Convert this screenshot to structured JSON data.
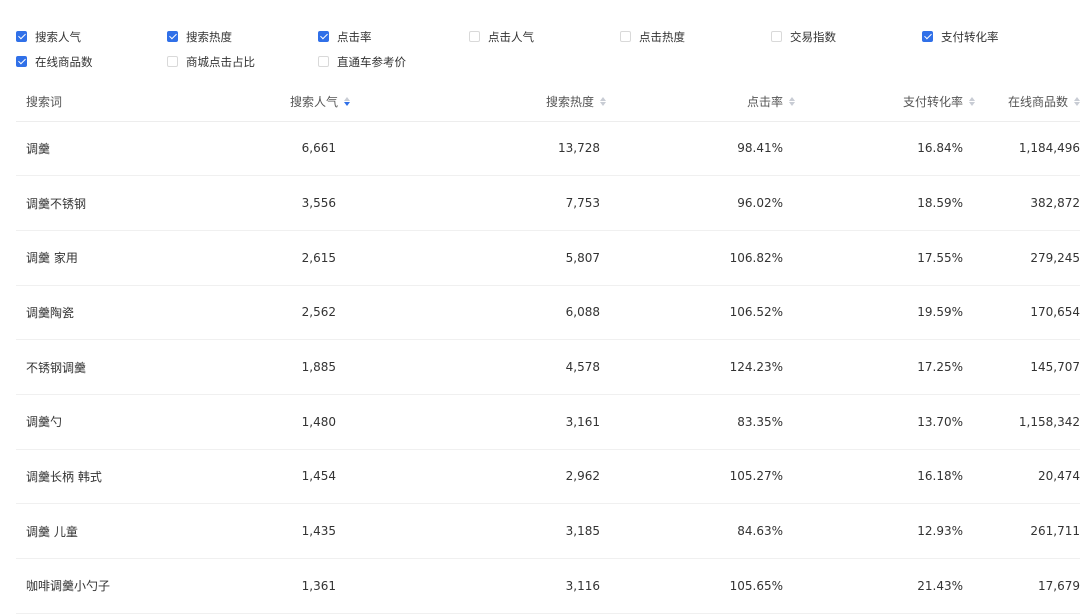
{
  "filters": [
    [
      {
        "label": "搜索人气",
        "checked": true
      },
      {
        "label": "搜索热度",
        "checked": true
      },
      {
        "label": "点击率",
        "checked": true
      },
      {
        "label": "点击人气",
        "checked": false
      },
      {
        "label": "点击热度",
        "checked": false
      },
      {
        "label": "交易指数",
        "checked": false
      },
      {
        "label": "支付转化率",
        "checked": true
      }
    ],
    [
      {
        "label": "在线商品数",
        "checked": true
      },
      {
        "label": "商城点击占比",
        "checked": false
      },
      {
        "label": "直通车参考价",
        "checked": false
      }
    ]
  ],
  "table": {
    "columns": [
      {
        "label": "搜索词",
        "sortable": false,
        "sort": "none"
      },
      {
        "label": "搜索人气",
        "sortable": true,
        "sort": "desc"
      },
      {
        "label": "搜索热度",
        "sortable": true,
        "sort": "none"
      },
      {
        "label": "点击率",
        "sortable": true,
        "sort": "none"
      },
      {
        "label": "支付转化率",
        "sortable": true,
        "sort": "none"
      },
      {
        "label": "在线商品数",
        "sortable": true,
        "sort": "none"
      }
    ],
    "rows": [
      [
        "调羹",
        "6,661",
        "13,728",
        "98.41%",
        "16.84%",
        "1,184,496"
      ],
      [
        "调羹不锈钢",
        "3,556",
        "7,753",
        "96.02%",
        "18.59%",
        "382,872"
      ],
      [
        "调羹 家用",
        "2,615",
        "5,807",
        "106.82%",
        "17.55%",
        "279,245"
      ],
      [
        "调羹陶瓷",
        "2,562",
        "6,088",
        "106.52%",
        "19.59%",
        "170,654"
      ],
      [
        "不锈钢调羹",
        "1,885",
        "4,578",
        "124.23%",
        "17.25%",
        "145,707"
      ],
      [
        "调羹勺",
        "1,480",
        "3,161",
        "83.35%",
        "13.70%",
        "1,158,342"
      ],
      [
        "调羹长柄 韩式",
        "1,454",
        "2,962",
        "105.27%",
        "16.18%",
        "20,474"
      ],
      [
        "调羹 儿童",
        "1,435",
        "3,185",
        "84.63%",
        "12.93%",
        "261,711"
      ],
      [
        "咖啡调羹小勺子",
        "1,361",
        "3,116",
        "105.65%",
        "21.43%",
        "17,679"
      ]
    ]
  },
  "colors": {
    "accent": "#3070e8",
    "text": "#333333",
    "border": "#f0f0f0"
  }
}
